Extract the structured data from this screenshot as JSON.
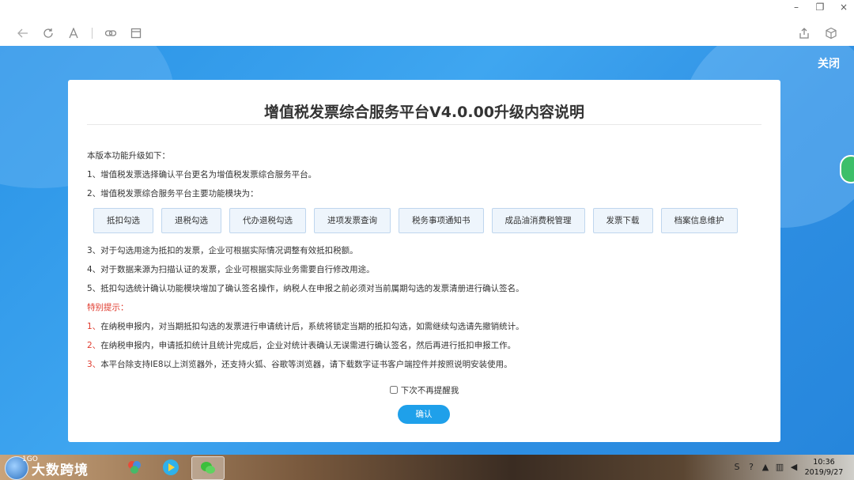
{
  "browser": {
    "window_controls": [
      "–",
      "❐",
      "×"
    ]
  },
  "page": {
    "close_label": "关闭"
  },
  "dialog": {
    "title": "增值税发票综合服务平台V4.0.00升级内容说明",
    "intro": "本版本功能升级如下：",
    "item1": "1、增值税发票选择确认平台更名为增值税发票综合服务平台。",
    "item2": "2、增值税发票综合服务平台主要功能模块为：",
    "modules": [
      "抵扣勾选",
      "退税勾选",
      "代办退税勾选",
      "进项发票查询",
      "税务事项通知书",
      "成品油消费税管理",
      "发票下载",
      "档案信息维护"
    ],
    "item3": "3、对于勾选用途为抵扣的发票，企业可根据实际情况调整有效抵扣税额。",
    "item4": "4、对于数据来源为扫描认证的发票，企业可根据实际业务需要自行修改用途。",
    "item5": "5、抵扣勾选统计确认功能模块增加了确认签名操作，纳税人在申报之前必须对当前属期勾选的发票清册进行确认签名。",
    "special_title": "特别提示：",
    "tips": [
      {
        "num": "1、",
        "text": "在纳税申报内，对当期抵扣勾选的发票进行申请统计后，系统将锁定当期的抵扣勾选，如需继续勾选请先撤销统计。"
      },
      {
        "num": "2、",
        "text": "在纳税申报内，申请抵扣统计且统计完成后，企业对统计表确认无误需进行确认签名，然后再进行抵扣申报工作。"
      },
      {
        "num": "3、",
        "text": "本平台除支持IE8以上浏览器外，还支持火狐、谷歌等浏览器，请下载数字证书客户端控件并按照说明安装使用。"
      }
    ],
    "remind_label": "下次不再提醒我",
    "confirm_label": "确认"
  },
  "taskbar": {
    "brand_small": "1GO",
    "brand": "大数跨境",
    "clock_time": "10:36",
    "clock_date": "2019/9/27"
  }
}
